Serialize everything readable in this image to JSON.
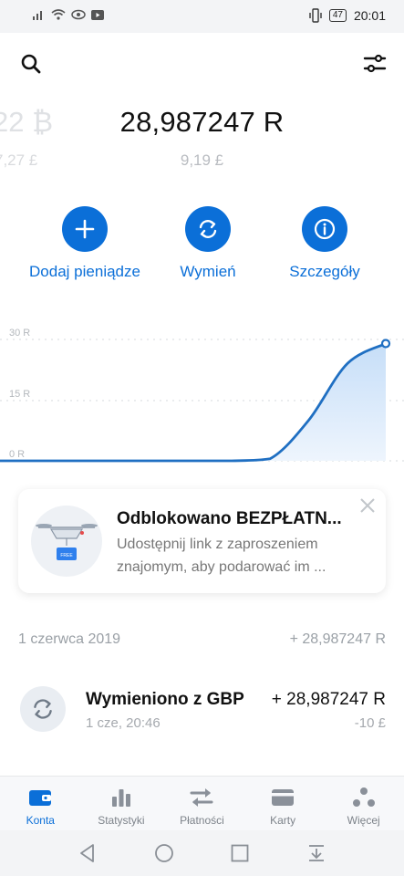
{
  "status_bar": {
    "battery": "47",
    "time": "20:01"
  },
  "header": {
    "search_icon": "search-icon",
    "filters_icon": "sliders-icon"
  },
  "balance": {
    "previous_amount": "22 ₿",
    "previous_sub": "7,27 £",
    "amount": "28,987247 R",
    "sub": "9,19 £"
  },
  "actions": [
    {
      "label": "Dodaj pieniądze",
      "icon": "plus-icon"
    },
    {
      "label": "Wymień",
      "icon": "exchange-icon"
    },
    {
      "label": "Szczegóły",
      "icon": "info-icon"
    }
  ],
  "chart_data": {
    "type": "area",
    "y_ticks": [
      "30 R",
      "15 R",
      "0 R"
    ],
    "ylim": [
      0,
      30
    ],
    "x": [
      0,
      1,
      2,
      3,
      4,
      5,
      6,
      7,
      8,
      9,
      10
    ],
    "values": [
      0,
      0,
      0,
      0,
      0,
      0,
      0,
      0.5,
      10,
      24,
      28.99
    ],
    "accent": "#1f6fc2"
  },
  "promo": {
    "title": "Odblokowano BEZPŁATN...",
    "text": "Udostępnij link z zaproszeniem znajomym, aby podarować im ...",
    "badge": "FREE"
  },
  "history": {
    "date": "1 czerwca 2019",
    "total": "+ 28,987247 R",
    "transactions": [
      {
        "title": "Wymieniono z GBP",
        "time": "1 cze, 20:46",
        "amount": "+ 28,987247 R",
        "amount_sub": "-10 £"
      }
    ]
  },
  "tabs": [
    {
      "label": "Konta",
      "icon": "wallet-icon",
      "active": true
    },
    {
      "label": "Statystyki",
      "icon": "bar-chart-icon",
      "active": false
    },
    {
      "label": "Płatności",
      "icon": "transfer-arrows-icon",
      "active": false
    },
    {
      "label": "Karty",
      "icon": "card-icon",
      "active": false
    },
    {
      "label": "Więcej",
      "icon": "more-dots-icon",
      "active": false
    }
  ],
  "colors": {
    "brand": "#0b6fd8",
    "muted": "#9aa0a6"
  }
}
